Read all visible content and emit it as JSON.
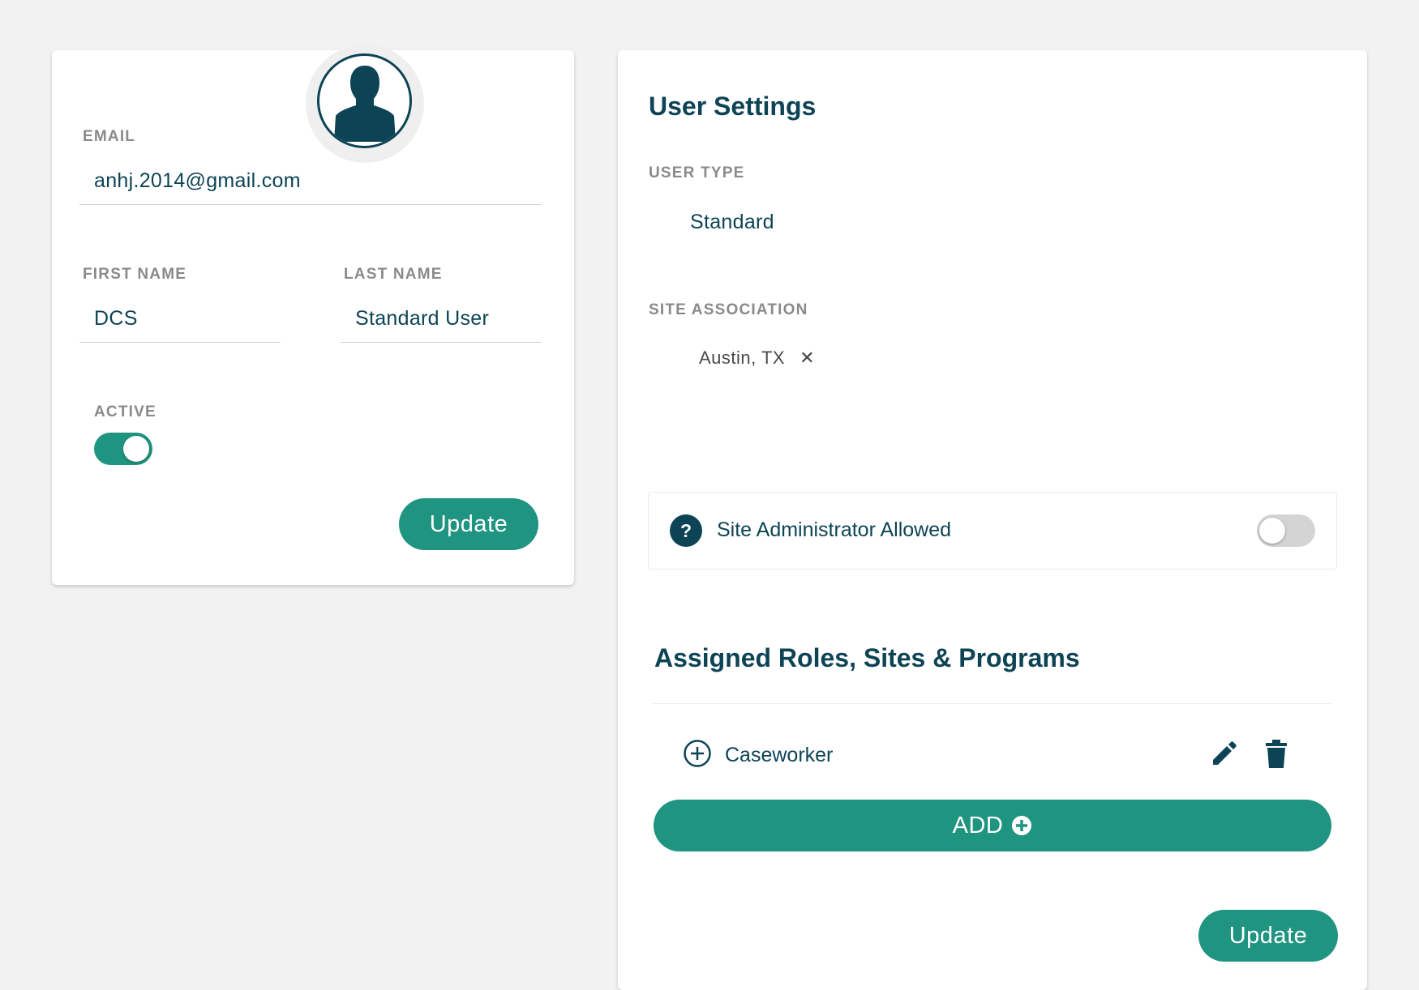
{
  "profile": {
    "email_label": "EMAIL",
    "email_value": "anhj.2014@gmail.com",
    "first_name_label": "FIRST NAME",
    "first_name_value": "DCS",
    "last_name_label": "LAST NAME",
    "last_name_value": "Standard User",
    "active_label": "ACTIVE",
    "active": true,
    "update_label": "Update",
    "avatar_icon": "user-silhouette-icon"
  },
  "settings": {
    "title": "User Settings",
    "user_type_label": "USER TYPE",
    "user_type_value": "Standard",
    "site_association_label": "SITE ASSOCIATION",
    "site_chips": [
      {
        "label": "Austin, TX",
        "remove_icon": "close-icon"
      }
    ],
    "site_admin_label": "Site Administrator Allowed",
    "site_admin_help_icon": "?",
    "site_admin_allowed": false,
    "roles_title": "Assigned Roles, Sites & Programs",
    "roles": [
      {
        "name": "Caseworker"
      }
    ],
    "add_label": "ADD",
    "update_label": "Update"
  },
  "colors": {
    "primary": "#1f9480",
    "text_dark": "#0d4455",
    "label_gray": "#8a8a8a",
    "background": "#f2f2f2"
  }
}
